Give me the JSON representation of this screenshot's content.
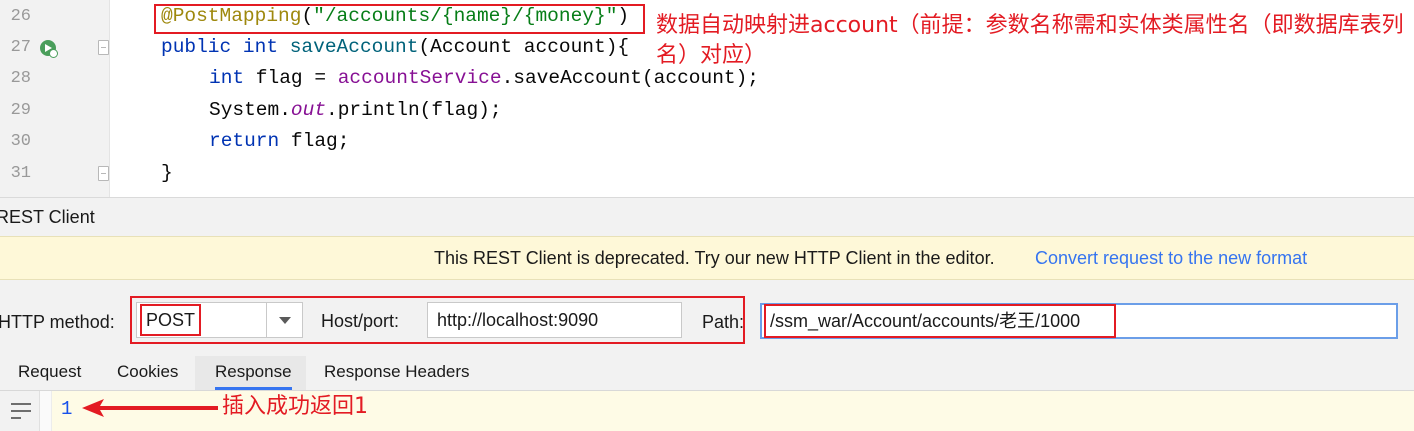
{
  "editor": {
    "lines": [
      {
        "num": "26",
        "tokens": [
          [
            "ann",
            "@PostMapping"
          ],
          [
            "txt",
            "("
          ],
          [
            "str",
            "\"/accounts/{name}/{money}\""
          ],
          [
            "txt",
            ")"
          ]
        ]
      },
      {
        "num": "27",
        "tokens": [
          [
            "kw",
            "public"
          ],
          [
            "txt",
            " "
          ],
          [
            "kw",
            "int"
          ],
          [
            "txt",
            " "
          ],
          [
            "fn",
            "saveAccount"
          ],
          [
            "txt",
            "(Account account){"
          ]
        ]
      },
      {
        "num": "28",
        "tokens": [
          [
            "kw",
            "int"
          ],
          [
            "txt",
            " flag = "
          ],
          [
            "fld",
            "accountService"
          ],
          [
            "txt",
            ".saveAccount(account);"
          ]
        ]
      },
      {
        "num": "29",
        "tokens": [
          [
            "txt",
            "System."
          ],
          [
            "stat",
            "out"
          ],
          [
            "txt",
            ".println(flag);"
          ]
        ]
      },
      {
        "num": "30",
        "tokens": [
          [
            "kw",
            "return"
          ],
          [
            "txt",
            " flag;"
          ]
        ]
      },
      {
        "num": "31",
        "tokens": [
          [
            "txt",
            "}"
          ]
        ]
      }
    ]
  },
  "annotations": {
    "mapping_note": "数据自动映射进account（前提：参数名称需和实体类属性名（即数据库表列名）对应）",
    "result_note": "插入成功返回1"
  },
  "panel": {
    "title": "REST Client",
    "banner_text": "This REST Client is deprecated. Try our new HTTP Client in the editor.",
    "banner_link": "Convert request to the new format"
  },
  "request": {
    "method_label": "HTTP method:",
    "method_value": "POST",
    "host_label": "Host/port:",
    "host_value": "http://localhost:9090",
    "path_label": "Path:",
    "path_value": "/ssm_war/Account/accounts/老王/1000"
  },
  "tabs": [
    {
      "label": "Request",
      "active": false
    },
    {
      "label": "Cookies",
      "active": false
    },
    {
      "label": "Response",
      "active": true
    },
    {
      "label": "Response Headers",
      "active": false
    }
  ],
  "response": {
    "body": "1"
  },
  "icons": {
    "run": "run-gutter-icon",
    "wrap": "soft-wrap-icon",
    "dropdown": "chevron-down-icon"
  },
  "colors": {
    "annotation_red": "#e31b23",
    "link_blue": "#3574f0",
    "banner_bg": "#fef8d8"
  }
}
